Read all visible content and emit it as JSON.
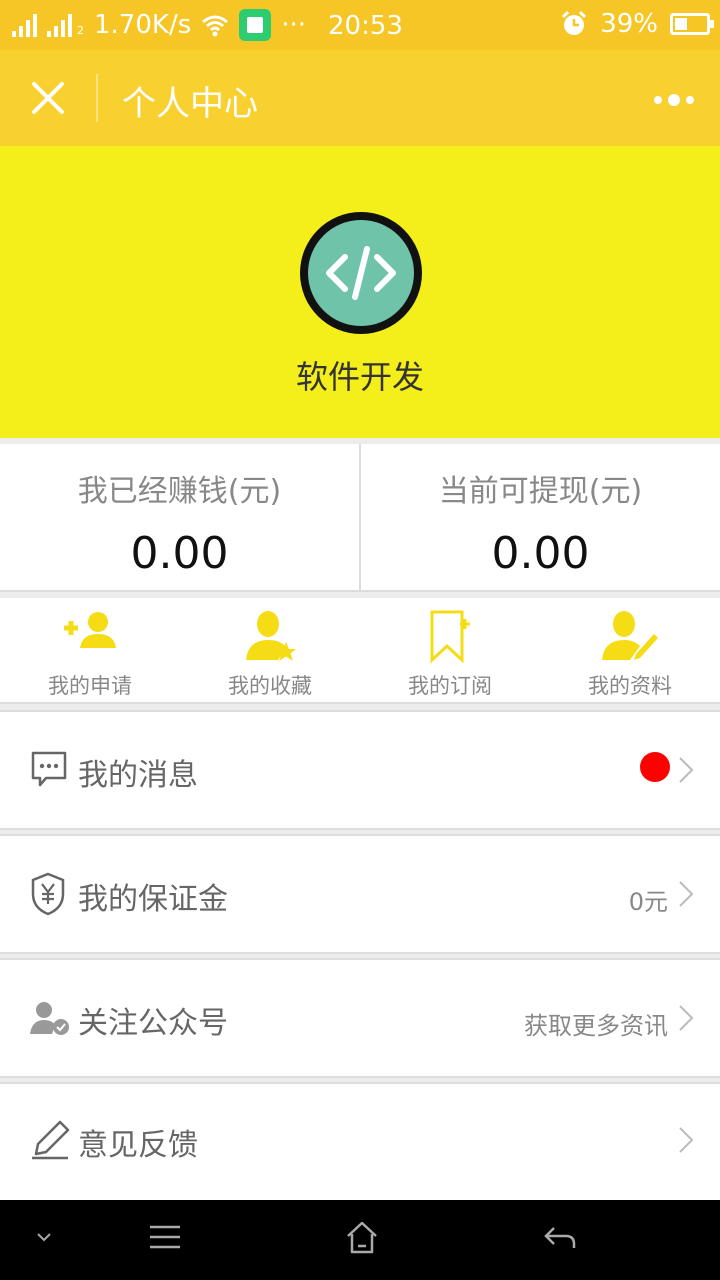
{
  "status_bar": {
    "net_speed": "1.70K/s",
    "dots": "···",
    "time": "20:53",
    "battery": "39%",
    "sim2_label": "2"
  },
  "header": {
    "title": "个人中心"
  },
  "profile": {
    "name": "软件开发"
  },
  "earnings": [
    {
      "label": "我已经赚钱(元)",
      "value": "0.00"
    },
    {
      "label": "当前可提现(元)",
      "value": "0.00"
    }
  ],
  "actions": [
    {
      "label": "我的申请",
      "icon": "add-user-icon"
    },
    {
      "label": "我的收藏",
      "icon": "user-star-icon"
    },
    {
      "label": "我的订阅",
      "icon": "bookmark-plus-icon"
    },
    {
      "label": "我的资料",
      "icon": "user-edit-icon"
    }
  ],
  "menu": [
    {
      "label": "我的消息",
      "value": "",
      "icon": "message-icon"
    },
    {
      "label": "我的保证金",
      "value": "0元",
      "icon": "shield-yen-icon"
    },
    {
      "label": "关注公众号",
      "value": "获取更多资讯",
      "icon": "user-check-icon"
    },
    {
      "label": "意见反馈",
      "value": "",
      "icon": "pen-icon"
    }
  ],
  "colors": {
    "accent": "#f8d02f",
    "profile_bg": "#f4ee1a",
    "badge": "#ff0000",
    "avatar_bg": "#6ec3a8"
  }
}
